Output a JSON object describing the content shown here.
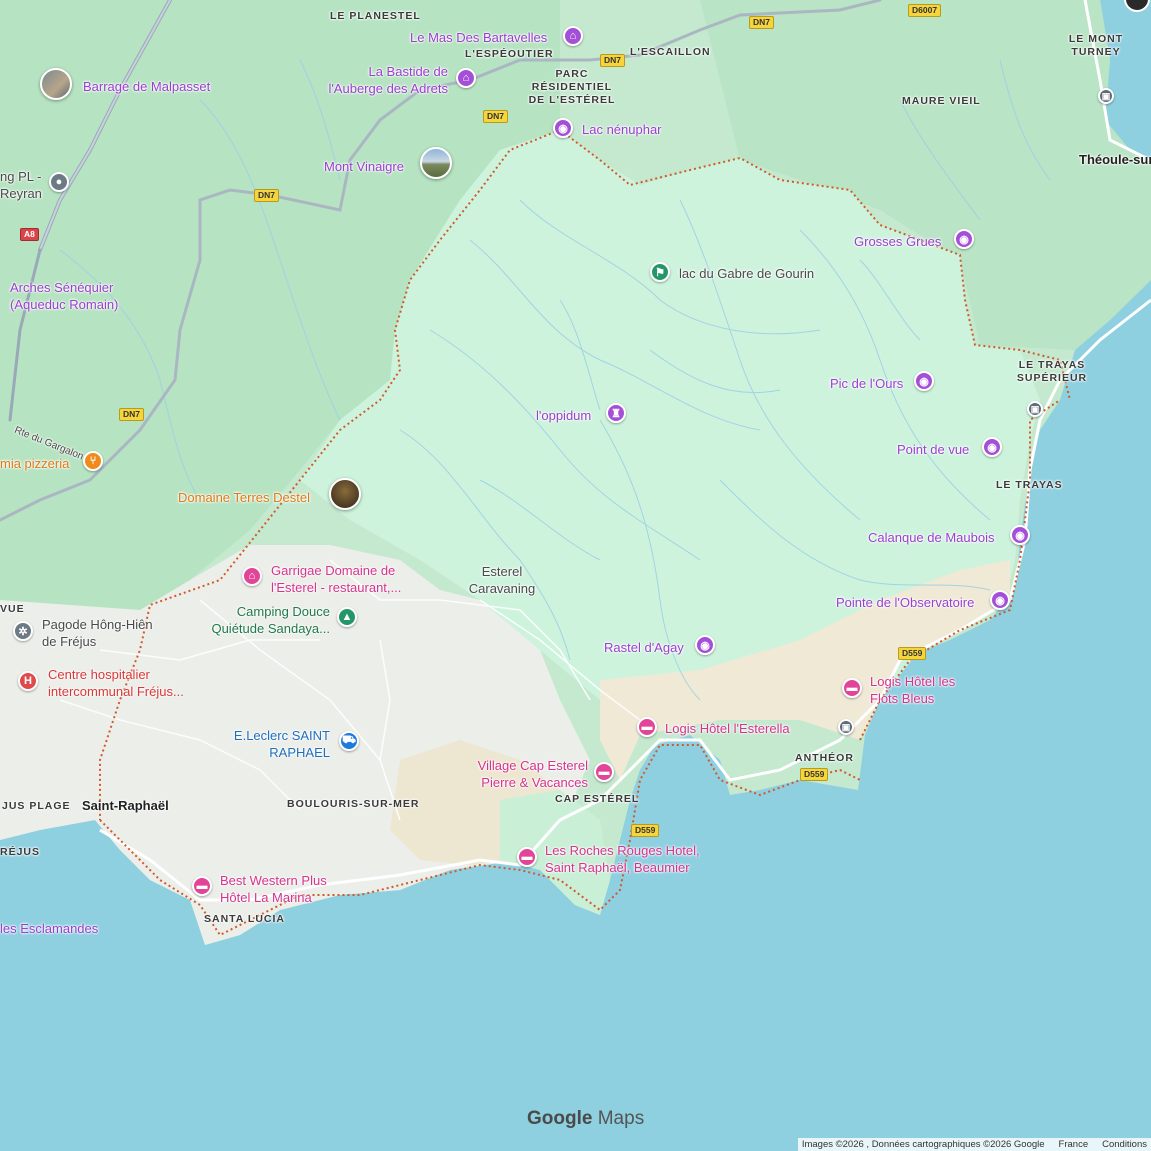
{
  "colors": {
    "sea": "#8ecfe0",
    "park": "#c9f0d8",
    "forest": "#b8e6c6",
    "urban": "#e9ebe7",
    "sand": "#efe9d8",
    "road": "#ffffff",
    "major_road": "#9aa8b8",
    "boundary": "#d2592a"
  },
  "roads": [
    {
      "ref": "DN7"
    },
    {
      "ref": "DN7"
    },
    {
      "ref": "DN7"
    },
    {
      "ref": "DN7"
    },
    {
      "ref": "DN7"
    },
    {
      "ref": "D6007"
    },
    {
      "ref": "A8"
    },
    {
      "ref": "D559"
    },
    {
      "ref": "D559"
    },
    {
      "ref": "D559"
    }
  ],
  "places": [
    {
      "name": "LE PLANESTEL"
    },
    {
      "name": "L'ESPÉOUTIER"
    },
    {
      "name": "L'ESCAILLON"
    },
    {
      "name": "PARC RÉSIDENTIEL DE L'ESTÉREL"
    },
    {
      "name": "MAURE VIEIL"
    },
    {
      "name": "LE MONT TURNEY"
    },
    {
      "name": "LE TRAYAS SUPÉRIEUR"
    },
    {
      "name": "LE TRAYAS"
    },
    {
      "name": "ANTHÉOR"
    },
    {
      "name": "CAP ESTÉREL"
    },
    {
      "name": "BOULOURIS-SUR-MER"
    },
    {
      "name": "SANTA LUCIA"
    },
    {
      "name": "JUS PLAGE"
    },
    {
      "name": "RÉJUS"
    },
    {
      "name": "VUE"
    }
  ],
  "towns": [
    {
      "name": "Saint-Raphaël"
    },
    {
      "name": "Théoule-sur"
    }
  ],
  "road_labels": [
    {
      "name": "Rte du Gargalon"
    }
  ],
  "pois": [
    {
      "name": "Barrage de Malpasset",
      "icon": "photo-thumbnail",
      "category": "purple"
    },
    {
      "name": "Le Mas Des Bartavelles",
      "icon": "hotel-icon",
      "category": "purple"
    },
    {
      "name": "La Bastide de l'Auberge des Adrets",
      "icon": "hotel-icon",
      "category": "purple"
    },
    {
      "name": "Lac nénuphar",
      "icon": "camera-icon",
      "category": "purple"
    },
    {
      "name": "Mont Vinaigre",
      "icon": "photo-thumbnail",
      "category": "purple"
    },
    {
      "name": "ng PL - Reyran",
      "icon": "circle-icon",
      "category": "gray"
    },
    {
      "name": "Grosses Grues",
      "icon": "camera-icon",
      "category": "purple"
    },
    {
      "name": "lac du Gabre de Gourin",
      "icon": "hiking-icon",
      "category": "green"
    },
    {
      "name": "Arches Sénéquier (Aqueduc Romain)",
      "icon": "none",
      "category": "purple"
    },
    {
      "name": "Pic de l'Ours",
      "icon": "camera-icon",
      "category": "purple"
    },
    {
      "name": "l'oppidum",
      "icon": "monument-icon",
      "category": "purple"
    },
    {
      "name": "Point de vue",
      "icon": "camera-icon",
      "category": "purple"
    },
    {
      "name": "mia pizzeria",
      "icon": "fork-icon",
      "category": "orange"
    },
    {
      "name": "Domaine Terres Destel",
      "icon": "photo-thumbnail",
      "category": "orange"
    },
    {
      "name": "Calanque de Maubois",
      "icon": "camera-icon",
      "category": "purple"
    },
    {
      "name": "Garrigae Domaine de l'Esterel - restaurant,...",
      "icon": "hotel-icon",
      "category": "pink"
    },
    {
      "name": "Esterel Caravaning",
      "icon": "none",
      "category": "gray"
    },
    {
      "name": "Camping Douce Quiétude Sandaya...",
      "icon": "tent-icon",
      "category": "green"
    },
    {
      "name": "Pointe de l'Observatoire",
      "icon": "camera-icon",
      "category": "purple"
    },
    {
      "name": "Pagode Hông-Hiên de Fréjus",
      "icon": "pagoda-icon",
      "category": "gray"
    },
    {
      "name": "Rastel d'Agay",
      "icon": "camera-icon",
      "category": "purple"
    },
    {
      "name": "Centre hospitalier intercommunal Fréjus...",
      "icon": "hospital-icon",
      "category": "red"
    },
    {
      "name": "Logis Hôtel les Flots Bleus",
      "icon": "bed-icon",
      "category": "pink"
    },
    {
      "name": "Logis Hôtel l'Esterella",
      "icon": "bed-icon",
      "category": "pink"
    },
    {
      "name": "E.Leclerc SAINT RAPHAEL",
      "icon": "cart-icon",
      "category": "purple"
    },
    {
      "name": "Village Cap Esterel Pierre & Vacances",
      "icon": "bed-icon",
      "category": "pink"
    },
    {
      "name": "Les Roches Rouges Hotel, Saint Raphaël, Beaumier",
      "icon": "bed-icon",
      "category": "pink"
    },
    {
      "name": "Best Western Plus Hôtel La Marina",
      "icon": "bed-icon",
      "category": "pink"
    },
    {
      "name": "les Esclamandes",
      "icon": "none",
      "category": "purple"
    }
  ],
  "brand": {
    "google": "Google",
    "maps": "Maps"
  },
  "attribution": {
    "credits": "Images ©2026 , Données cartographiques ©2026 Google",
    "country": "France",
    "terms": "Conditions"
  }
}
